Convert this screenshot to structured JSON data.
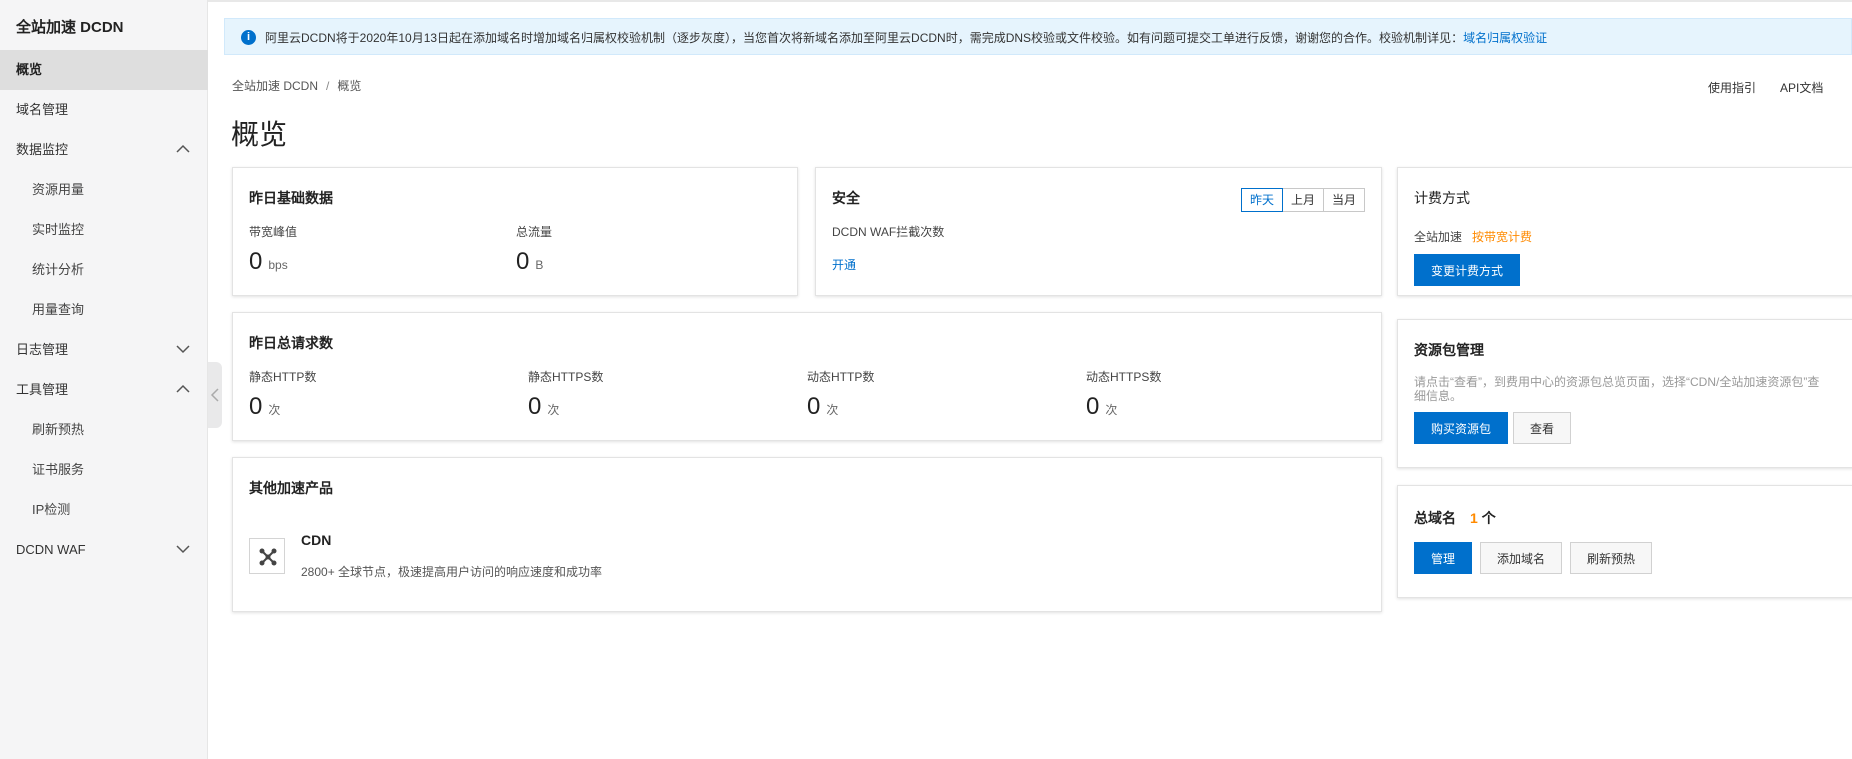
{
  "sidebar": {
    "title": "全站加速 DCDN",
    "items": [
      {
        "label": "概览"
      },
      {
        "label": "域名管理"
      },
      {
        "label": "数据监控"
      },
      {
        "label": "资源用量"
      },
      {
        "label": "实时监控"
      },
      {
        "label": "统计分析"
      },
      {
        "label": "用量查询"
      },
      {
        "label": "日志管理"
      },
      {
        "label": "工具管理"
      },
      {
        "label": "刷新预热"
      },
      {
        "label": "证书服务"
      },
      {
        "label": "IP检测"
      },
      {
        "label": "DCDN WAF"
      }
    ]
  },
  "notice": {
    "text": "阿里云DCDN将于2020年10月13日起在添加域名时增加域名归属权校验机制（逐步灰度），当您首次将新域名添加至阿里云DCDN时，需完成DNS校验或文件校验。如有问题可提交工单进行反馈，谢谢您的合作。校验机制详见：",
    "link": "域名归属权验证"
  },
  "breadcrumb": {
    "root": "全站加速 DCDN",
    "sep": "/",
    "current": "概览"
  },
  "header": {
    "title": "概览",
    "links": [
      "使用指引",
      "API文档"
    ]
  },
  "basic_data": {
    "title": "昨日基础数据",
    "metrics": [
      {
        "label": "带宽峰值",
        "value": "0",
        "unit": "bps"
      },
      {
        "label": "总流量",
        "value": "0",
        "unit": "B"
      }
    ]
  },
  "security": {
    "title": "安全",
    "tabs": [
      "昨天",
      "上月",
      "当月"
    ],
    "label": "DCDN WAF拦截次数",
    "action": "开通"
  },
  "billing": {
    "title": "计费方式",
    "product": "全站加速",
    "method": "按带宽计费",
    "button": "变更计费方式"
  },
  "requests": {
    "title": "昨日总请求数",
    "metrics": [
      {
        "label": "静态HTTP数",
        "value": "0",
        "unit": "次"
      },
      {
        "label": "静态HTTPS数",
        "value": "0",
        "unit": "次"
      },
      {
        "label": "动态HTTP数",
        "value": "0",
        "unit": "次"
      },
      {
        "label": "动态HTTPS数",
        "value": "0",
        "unit": "次"
      }
    ]
  },
  "packages": {
    "title": "资源包管理",
    "desc_line1": "请点击“查看”，到费用中心的资源包总览页面，选择“CDN/全站加速资源包”查",
    "desc_line2": "细信息。",
    "buy": "购买资源包",
    "view": "查看"
  },
  "other_products": {
    "title": "其他加速产品",
    "product_name": "CDN",
    "product_desc": "2800+ 全球节点，极速提高用户访问的响应速度和成功率"
  },
  "domains": {
    "title": "总域名",
    "count": "1",
    "unit": "个",
    "buttons": [
      "管理",
      "添加域名",
      "刷新预热"
    ]
  },
  "colors": {
    "accent": "#0070cc",
    "orange": "#ff8a00",
    "brand": "#ff6a00"
  }
}
